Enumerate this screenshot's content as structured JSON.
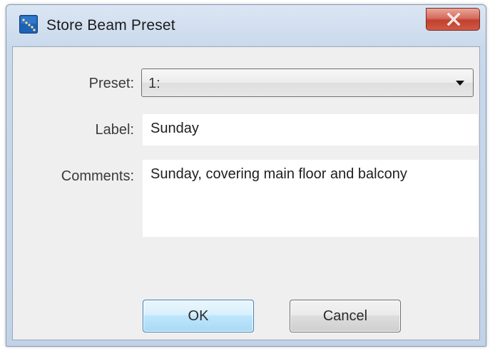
{
  "window": {
    "title": "Store Beam Preset",
    "icon": "app-icon",
    "close_icon": "close-icon"
  },
  "form": {
    "preset_label": "Preset:",
    "preset_value": "1:",
    "label_label": "Label:",
    "label_value": "Sunday",
    "comments_label": "Comments:",
    "comments_value": "Sunday, covering main floor and balcony"
  },
  "buttons": {
    "ok": "OK",
    "cancel": "Cancel"
  },
  "colors": {
    "title_bar": "#c9d9ec",
    "close_button": "#c9503d",
    "dialog_background": "#efefef",
    "ok_border": "#3c7fb1"
  }
}
